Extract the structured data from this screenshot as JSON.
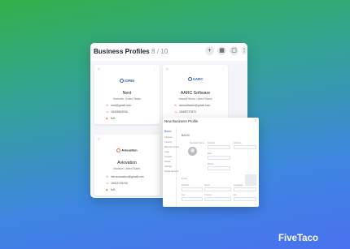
{
  "header": {
    "title": "Business Profiles",
    "count": "8 / 10"
  },
  "toolbar": {
    "add_icon": "+",
    "grid_icon": "▦",
    "list_icon": "▢",
    "more_icon": "⋮"
  },
  "cards": [
    {
      "logo": "IORM",
      "name": "Next",
      "location": "Hartsville, United States",
      "email": "next@gmail.com",
      "phone": "18453693036",
      "status": "N/A"
    },
    {
      "logo": "AARC",
      "name": "AARC Software",
      "location": "Newark Bears, United States",
      "email": "aarcsoftware@gmail.com",
      "phone": "18408737870",
      "status": "N/A"
    },
    {
      "logo": "Aviovation",
      "name": "Aviovation",
      "location": "Madison, United States",
      "email": "info.aviovation@gmail.com",
      "phone": "19413725240",
      "status": "N/A"
    }
  ],
  "panel": {
    "title": "New Business Profile",
    "close": "×",
    "nav": [
      "Basic",
      "Address",
      "Country",
      "Business Hours",
      "Logo",
      "Contact",
      "Social",
      "Settings",
      "Social Network"
    ],
    "section": "BASIC",
    "fields": [
      "Business Name",
      "Industry",
      "Address",
      "Size",
      "Phone",
      "Email",
      "Website",
      "Hours",
      "Language",
      "Fax",
      "Country",
      "Zip"
    ]
  },
  "brand": "FiveTaco"
}
